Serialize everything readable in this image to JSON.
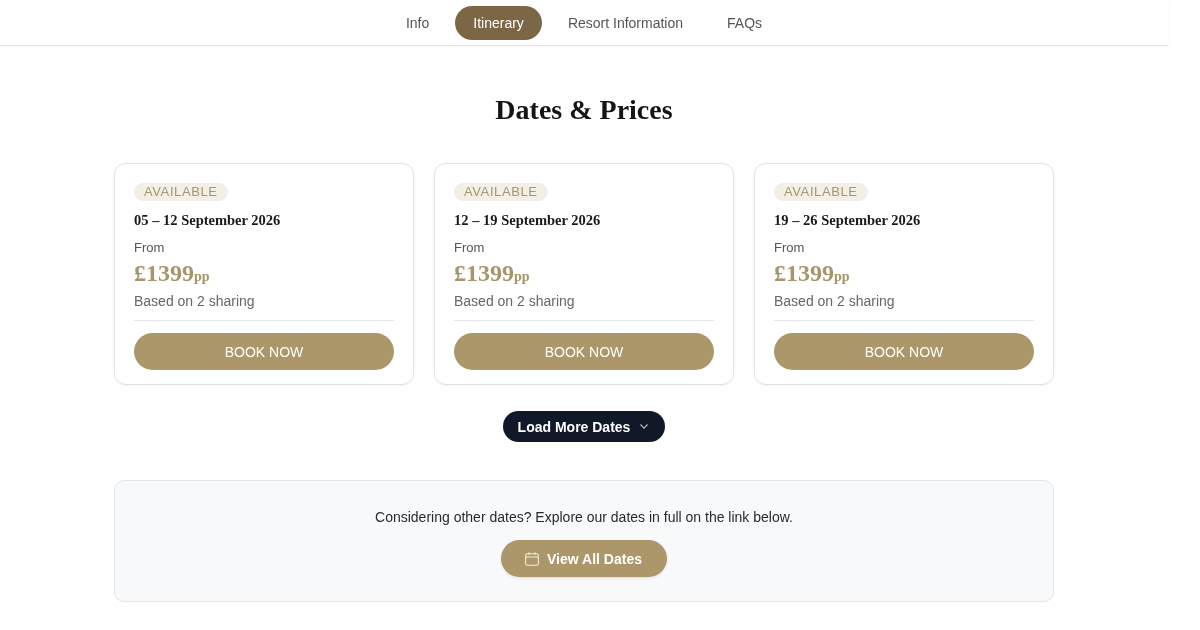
{
  "nav": {
    "tabs": [
      {
        "label": "Info",
        "selected": false
      },
      {
        "label": "Itinerary",
        "selected": true
      },
      {
        "label": "Resort Information",
        "selected": false
      },
      {
        "label": "FAQs",
        "selected": false
      }
    ]
  },
  "section": {
    "title": "Dates & Prices"
  },
  "dates": [
    {
      "status": "AVAILABLE",
      "range": "05 – 12 September 2026",
      "from_label": "From",
      "price": "£1399",
      "price_unit": "pp",
      "note": "Based on 2 sharing",
      "button": "BOOK NOW"
    },
    {
      "status": "AVAILABLE",
      "range": "12 – 19 September 2026",
      "from_label": "From",
      "price": "£1399",
      "price_unit": "pp",
      "note": "Based on 2 sharing",
      "button": "BOOK NOW"
    },
    {
      "status": "AVAILABLE",
      "range": "19 – 26 September 2026",
      "from_label": "From",
      "price": "£1399",
      "price_unit": "pp",
      "note": "Based on 2 sharing",
      "button": "BOOK NOW"
    }
  ],
  "load_more": {
    "label": "Load More Dates"
  },
  "other_dates": {
    "text": "Considering other dates? Explore our dates in full on the link below.",
    "button": "View All Dates"
  }
}
